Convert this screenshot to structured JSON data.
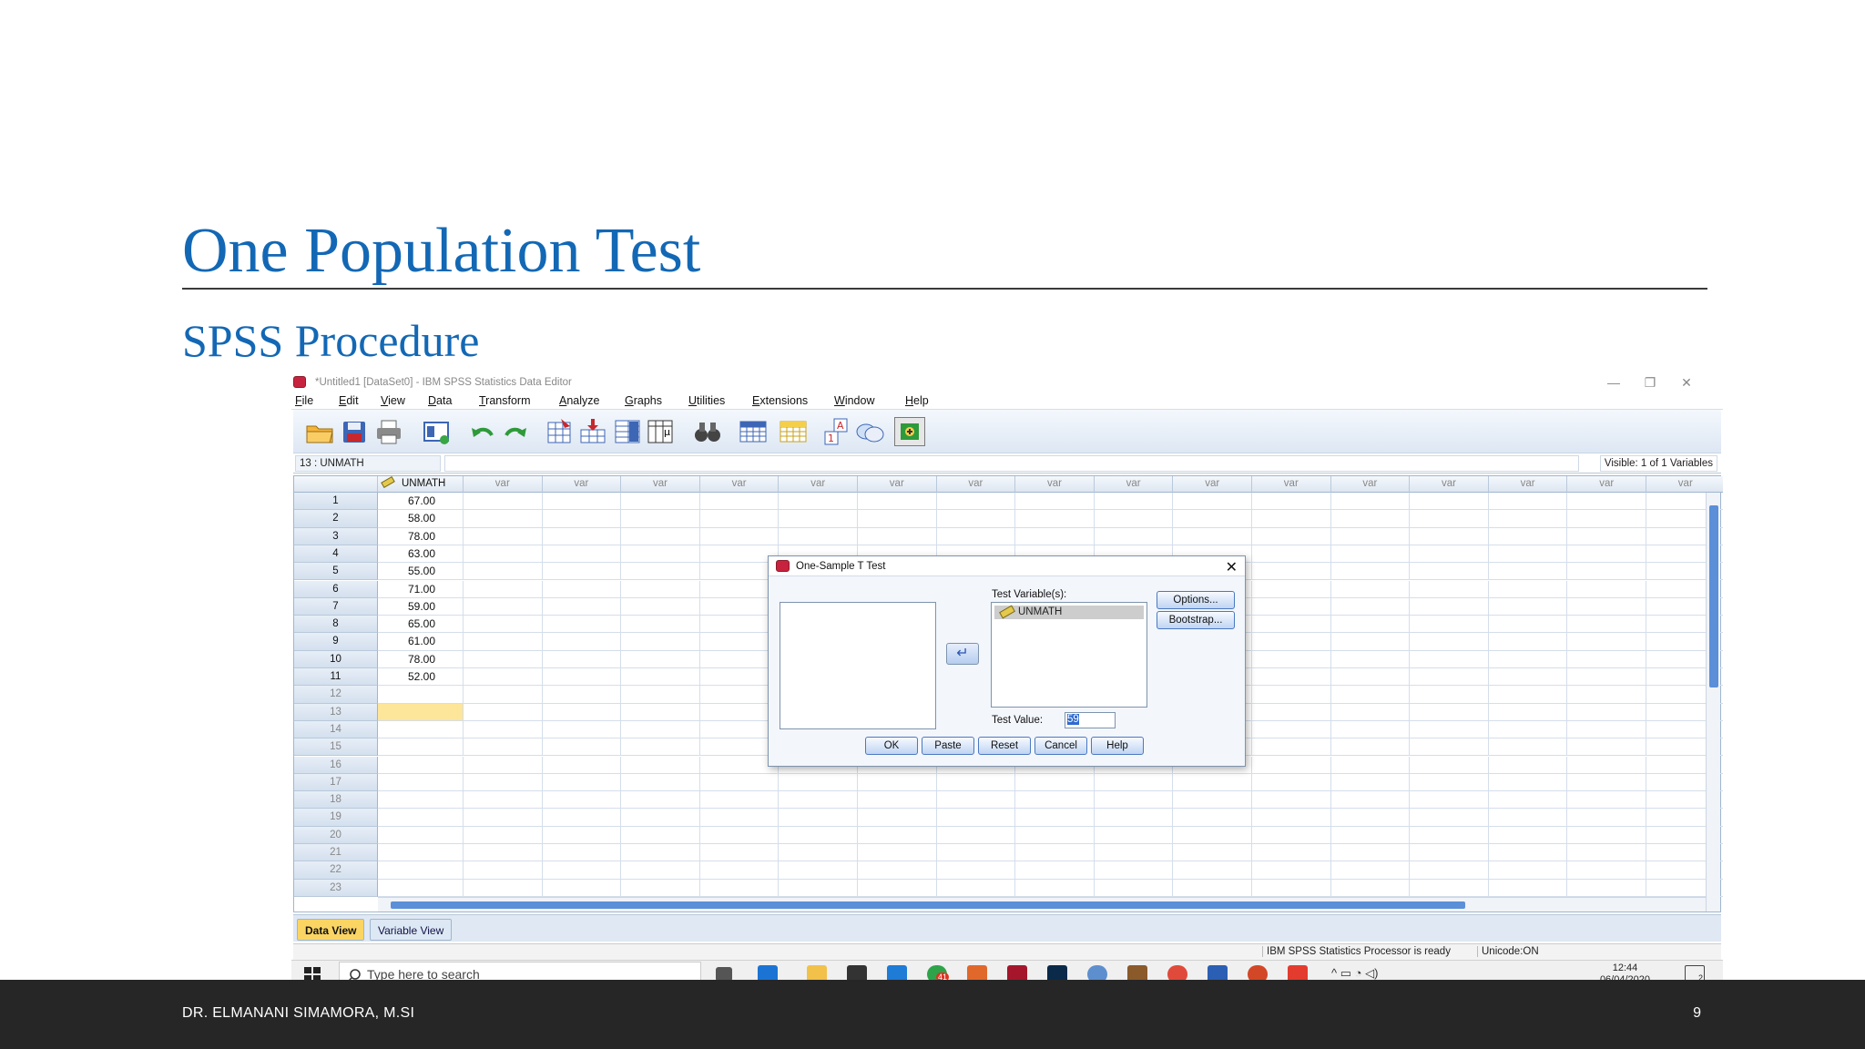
{
  "slide": {
    "title": "One Population Test",
    "subtitle": "SPSS Procedure",
    "footer_author": "DR. ELMANANI SIMAMORA, M.SI",
    "page_number": "9"
  },
  "window": {
    "title": "*Untitled1 [DataSet0] - IBM SPSS Statistics Data Editor",
    "minimize": "—",
    "restore": "❐",
    "close": "✕"
  },
  "menu": [
    "File",
    "Edit",
    "View",
    "Data",
    "Transform",
    "Analyze",
    "Graphs",
    "Utilities",
    "Extensions",
    "Window",
    "Help"
  ],
  "cellbar": {
    "ref": "13 : UNMATH",
    "visible": "Visible: 1 of 1 Variables"
  },
  "grid": {
    "first_column": "UNMATH",
    "empty_column": "var",
    "rows": [
      "1",
      "2",
      "3",
      "4",
      "5",
      "6",
      "7",
      "8",
      "9",
      "10",
      "11",
      "12",
      "13",
      "14",
      "15",
      "16",
      "17",
      "18",
      "19",
      "20",
      "21",
      "22",
      "23"
    ],
    "values": [
      "67.00",
      "58.00",
      "78.00",
      "63.00",
      "55.00",
      "71.00",
      "59.00",
      "65.00",
      "61.00",
      "78.00",
      "52.00"
    ]
  },
  "tabs": {
    "data_view": "Data View",
    "variable_view": "Variable View"
  },
  "status": {
    "processor": "IBM SPSS Statistics Processor is ready",
    "unicode": "Unicode:ON"
  },
  "taskbar": {
    "search_placeholder": "Type here to search",
    "time": "12:44",
    "date": "06/04/2020",
    "badge": "41",
    "notif": "2"
  },
  "dialog": {
    "title": "One-Sample T Test",
    "close": "✕",
    "test_variables_label": "Test Variable(s):",
    "test_variable_item": "UNMATH",
    "test_value_label": "Test Value:",
    "test_value": "59",
    "arrow": "↵",
    "buttons": {
      "options": "Options...",
      "bootstrap": "Bootstrap...",
      "ok": "OK",
      "paste": "Paste",
      "reset": "Reset",
      "cancel": "Cancel",
      "help": "Help"
    }
  },
  "colors": {
    "accent": "#1368b5",
    "footer": "#262626",
    "active_cell": "#fde59a",
    "data_tab": "#fbd564"
  }
}
